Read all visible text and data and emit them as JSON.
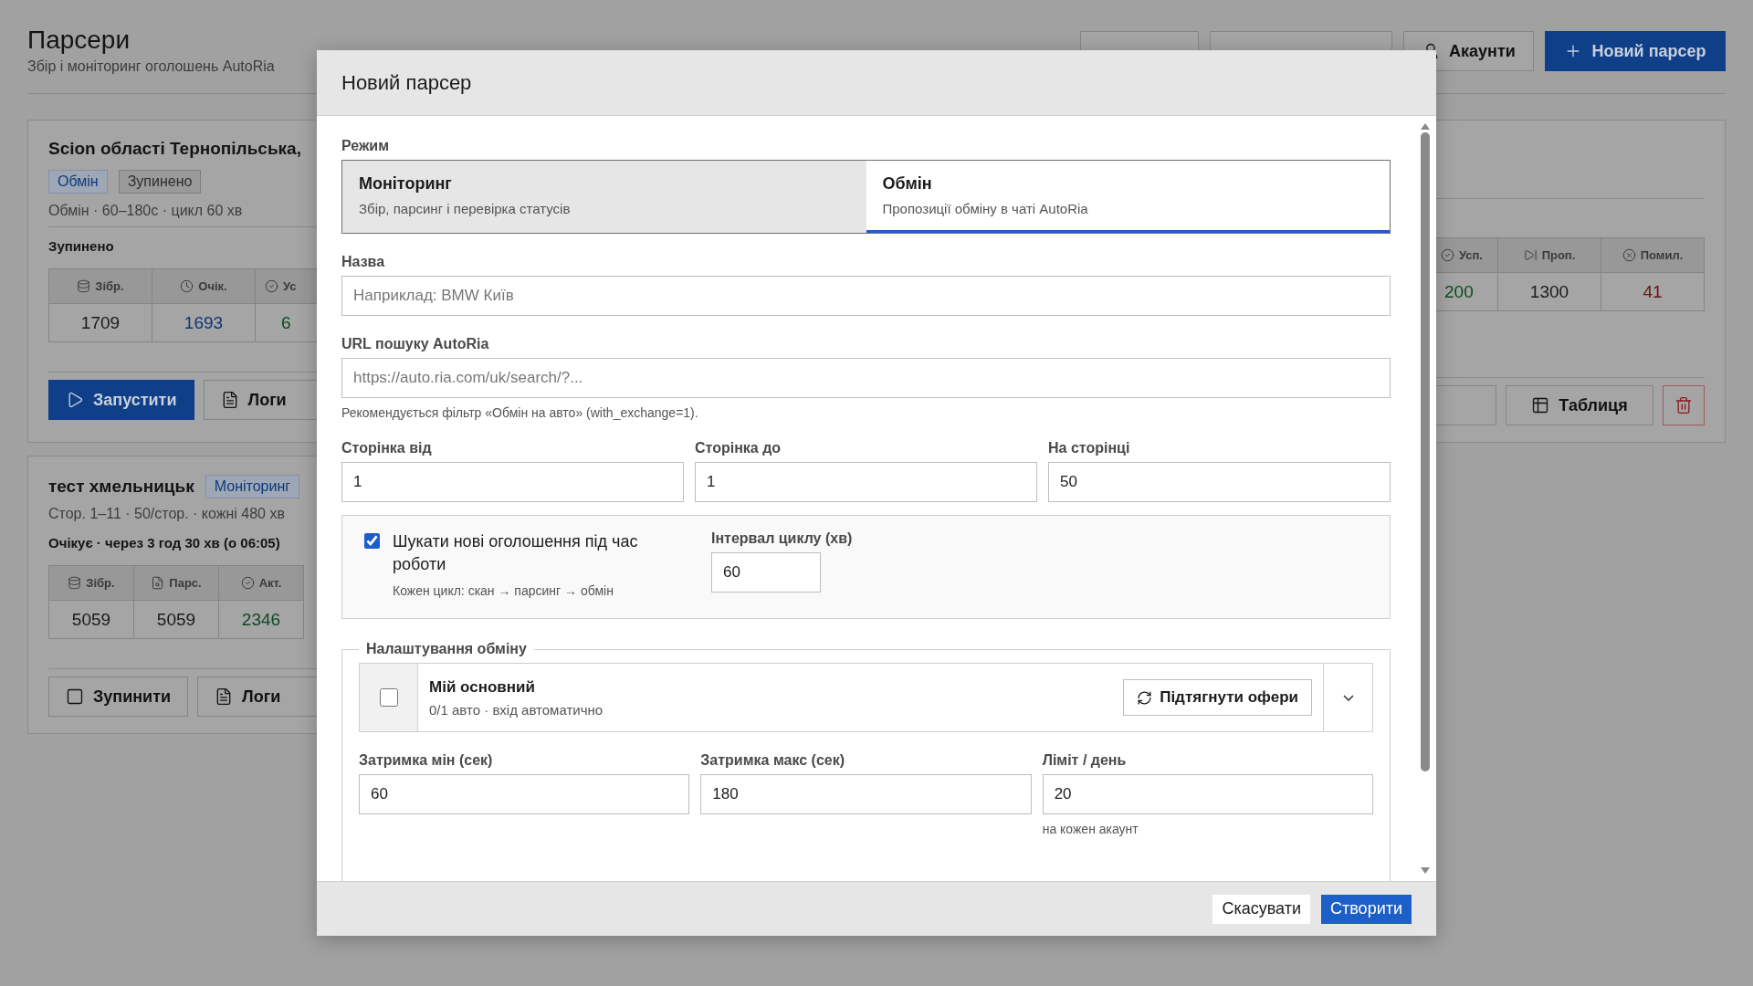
{
  "page": {
    "title": "Парсери",
    "subtitle": "Збір і моніторинг оголошень AutoRia"
  },
  "header_buttons": [
    {
      "kind": "outline"
    },
    {
      "kind": "outline"
    },
    {
      "kind": "outline",
      "label": "Акаунти"
    },
    {
      "kind": "primary",
      "label": "Новий парсер"
    }
  ],
  "cards": [
    {
      "title": "Scion області Тернопільська,",
      "badges": [
        {
          "label": "Обмін",
          "kind": "mode"
        },
        {
          "label": "Зупинено",
          "kind": "status"
        }
      ],
      "meta": "Обмін · 60–180с · цикл 60 хв",
      "status": "Зупинено",
      "stats_left": [
        {
          "label": "Зібр.",
          "value": "1709",
          "color": "#1a1a1a"
        },
        {
          "label": "Очік.",
          "value": "1693",
          "color": "#0d3575"
        },
        {
          "label": "Ус",
          "value": "6",
          "color": "#0d4a22"
        }
      ],
      "stats_right": [
        {
          "label": "Усп.",
          "value": "200",
          "color": "#0d4a22"
        },
        {
          "label": "Проп.",
          "value": "1300",
          "color": "#1a1a1a"
        },
        {
          "label": "Помил.",
          "value": "41",
          "color": "#6e0f12"
        }
      ],
      "actions_left": [
        {
          "kind": "primary",
          "label": "Запустити"
        },
        {
          "kind": "outline",
          "label": "Логи"
        }
      ],
      "actions_right": [
        {
          "kind": "outline"
        },
        {
          "kind": "outline",
          "label": "Таблиця"
        },
        {
          "kind": "danger"
        }
      ]
    },
    {
      "title": "тест хмельницьк",
      "badges": [
        {
          "label": "Моніторинг",
          "kind": "mode"
        }
      ],
      "meta": "Стор. 1–11 · 50/стор. · кожні 480 хв",
      "status": "Очікує · через 3 год 30 хв (о 06:05)",
      "stats_left": [
        {
          "label": "Зібр.",
          "value": "5059",
          "color": "#1a1a1a"
        },
        {
          "label": "Парс.",
          "value": "5059",
          "color": "#1a1a1a"
        },
        {
          "label": "Акт.",
          "value": "2346",
          "color": "#0d4a22"
        }
      ],
      "actions_left": [
        {
          "kind": "outline",
          "label": "Зупинити"
        },
        {
          "kind": "outline",
          "label": "Логи"
        }
      ]
    }
  ],
  "dialog": {
    "title": "Новий парсер",
    "mode_label": "Режим",
    "modes": [
      {
        "title": "Моніторинг",
        "description": "Збір, парсинг і перевірка статусів",
        "selected": false
      },
      {
        "title": "Обмін",
        "description": "Пропозиції обміну в чаті AutoRia",
        "selected": true
      }
    ],
    "name": {
      "label": "Назва",
      "placeholder": "Наприклад: BMW Київ"
    },
    "url": {
      "label": "URL пошуку AutoRia",
      "placeholder": "https://auto.ria.com/uk/search/?...",
      "hint": "Рекомендується фільтр «Обмін на авто» (with_exchange=1)."
    },
    "pages": [
      {
        "label": "Сторінка від",
        "value": "1"
      },
      {
        "label": "Сторінка до",
        "value": "1"
      },
      {
        "label": "На сторінці",
        "value": "50"
      }
    ],
    "watch": {
      "checked": true,
      "label": "Шукати нові оголошення під час роботи",
      "hint": "Кожен цикл: скан → парсинг → обмін"
    },
    "interval": {
      "label": "Інтервал циклу (хв)",
      "value": "60"
    },
    "exchange": {
      "legend": "Налаштування обміну",
      "account": {
        "checked": false,
        "name": "Мій основний",
        "details": "0/1 авто · вхід автоматично",
        "button": "Підтягнути офери",
        "expanded": false
      },
      "fields": [
        {
          "label": "Затримка мін (сек)",
          "value": "60"
        },
        {
          "label": "Затримка макс (сек)",
          "value": "180"
        },
        {
          "label": "Ліміт / день",
          "value": "20",
          "hint": "на кожен акаунт"
        }
      ]
    },
    "buttons": [
      {
        "kind": "secondary",
        "label": "Скасувати"
      },
      {
        "kind": "primary",
        "label": "Створити"
      }
    ]
  }
}
